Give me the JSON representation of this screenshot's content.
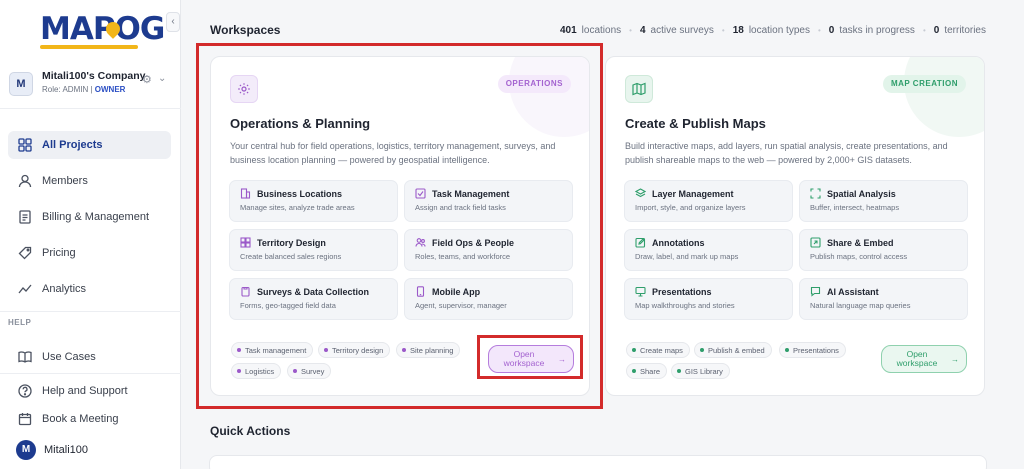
{
  "brand": {
    "logo_text": "MAPOG"
  },
  "company": {
    "avatar_letter": "M",
    "name": "Mitali100's Company",
    "role_prefix": "Role: ADMIN | ",
    "role_owner": "OWNER"
  },
  "sidebar": {
    "items": [
      {
        "label": "All Projects",
        "icon": "grid-icon"
      },
      {
        "label": "Members",
        "icon": "user-icon"
      },
      {
        "label": "Billing & Management",
        "icon": "document-icon"
      },
      {
        "label": "Pricing",
        "icon": "tag-icon"
      },
      {
        "label": "Analytics",
        "icon": "trend-icon"
      }
    ],
    "help_label": "HELP",
    "help_items": [
      {
        "label": "Use Cases",
        "icon": "book-icon"
      },
      {
        "label": "Help and Support",
        "icon": "question-icon"
      },
      {
        "label": "Book a Meeting",
        "icon": "calendar-icon"
      }
    ],
    "user": {
      "avatar_letter": "M",
      "name": "Mitali100"
    }
  },
  "header": {
    "title": "Workspaces",
    "stats": [
      {
        "value": "401",
        "label": "locations"
      },
      {
        "value": "4",
        "label": "active surveys"
      },
      {
        "value": "18",
        "label": "location types"
      },
      {
        "value": "0",
        "label": "tasks in progress"
      },
      {
        "value": "0",
        "label": "territories"
      }
    ]
  },
  "cards": [
    {
      "badge": "OPERATIONS",
      "title": "Operations & Planning",
      "description": "Your central hub for field operations, logistics, territory management, surveys, and business location planning — powered by geospatial intelligence.",
      "features": [
        {
          "title": "Business Locations",
          "sub": "Manage sites, analyze trade areas",
          "icon": "building-icon"
        },
        {
          "title": "Task Management",
          "sub": "Assign and track field tasks",
          "icon": "checkbox-icon"
        },
        {
          "title": "Territory Design",
          "sub": "Create balanced sales regions",
          "icon": "grid-icon"
        },
        {
          "title": "Field Ops & People",
          "sub": "Roles, teams, and workforce",
          "icon": "people-icon"
        },
        {
          "title": "Surveys & Data Collection",
          "sub": "Forms, geo-tagged field data",
          "icon": "clipboard-icon"
        },
        {
          "title": "Mobile App",
          "sub": "Agent, supervisor, manager",
          "icon": "phone-icon"
        }
      ],
      "tags": [
        "Task management",
        "Territory design",
        "Site planning",
        "Logistics",
        "Survey"
      ],
      "button_label": "Open workspace",
      "accent": "#9b59c9"
    },
    {
      "badge": "MAP CREATION",
      "title": "Create & Publish Maps",
      "description": "Build interactive maps, add layers, run spatial analysis, create presentations, and publish shareable maps to the web — powered by 2,000+ GIS datasets.",
      "features": [
        {
          "title": "Layer Management",
          "sub": "Import, style, and organize layers",
          "icon": "layers-icon"
        },
        {
          "title": "Spatial Analysis",
          "sub": "Buffer, intersect, heatmaps",
          "icon": "scan-icon"
        },
        {
          "title": "Annotations",
          "sub": "Draw, label, and mark up maps",
          "icon": "edit-icon"
        },
        {
          "title": "Share & Embed",
          "sub": "Publish maps, control access",
          "icon": "share-icon"
        },
        {
          "title": "Presentations",
          "sub": "Map walkthroughs and stories",
          "icon": "monitor-icon"
        },
        {
          "title": "AI Assistant",
          "sub": "Natural language map queries",
          "icon": "chat-icon"
        }
      ],
      "tags": [
        "Create maps",
        "Publish & embed",
        "Presentations",
        "Share",
        "GIS Library"
      ],
      "button_label": "Open workspace",
      "accent": "#2f9e6b"
    }
  ],
  "quick_actions": {
    "title": "Quick Actions"
  }
}
